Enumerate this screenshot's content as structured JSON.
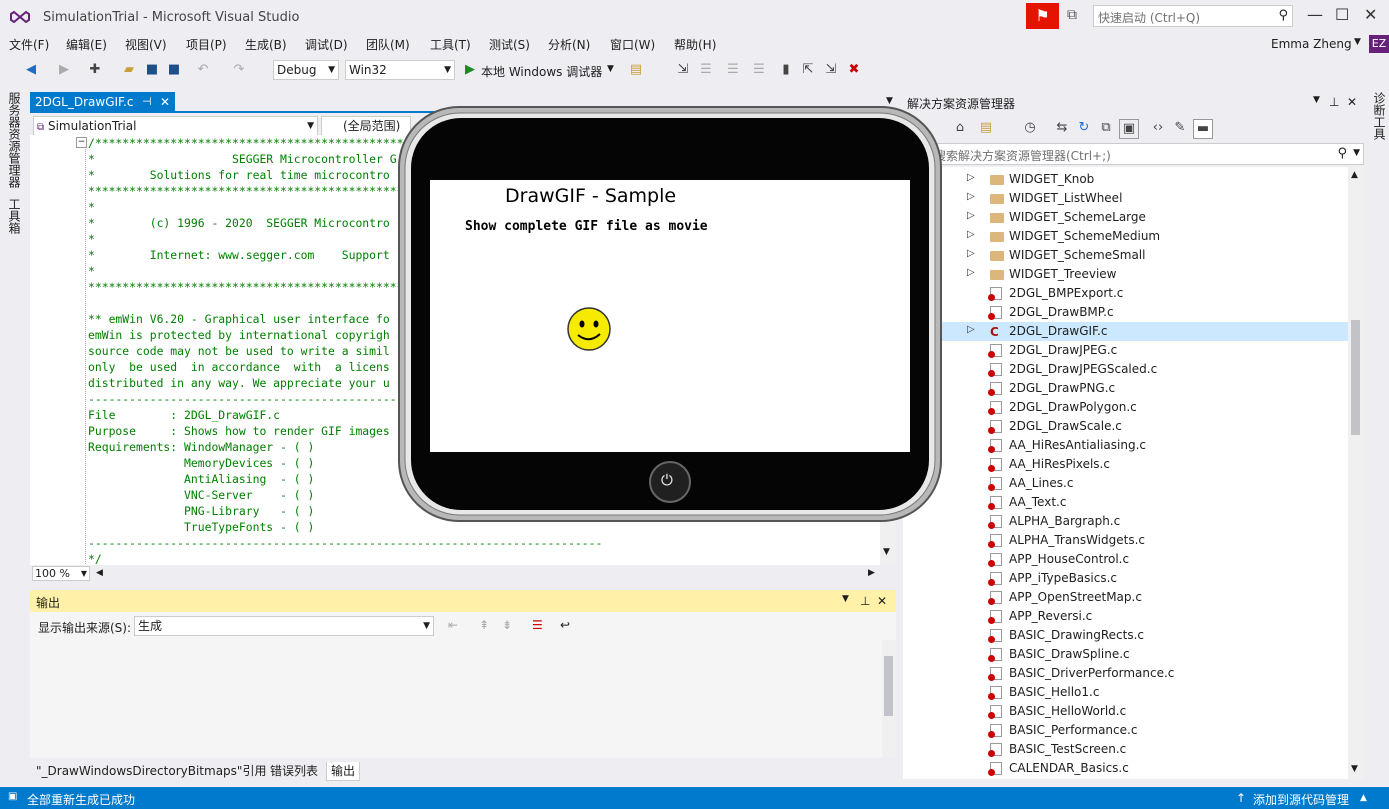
{
  "window": {
    "title": "SimulationTrial - Microsoft Visual Studio",
    "quick_launch_placeholder": "快速启动 (Ctrl+Q)",
    "user_name": "Emma Zheng",
    "user_initials": "EZ"
  },
  "menu": [
    "文件(F)",
    "编辑(E)",
    "视图(V)",
    "项目(P)",
    "生成(B)",
    "调试(D)",
    "团队(M)",
    "工具(T)",
    "测试(S)",
    "分析(N)",
    "窗口(W)",
    "帮助(H)"
  ],
  "toolbar": {
    "config": "Debug",
    "platform": "Win32",
    "run_label": "本地 Windows 调试器"
  },
  "left_rail": [
    "服务器资源管理器",
    "工具箱"
  ],
  "right_rail": [
    "诊断工具"
  ],
  "editor": {
    "tab_name": "2DGL_DrawGIF.c",
    "project_dropdown": "SimulationTrial",
    "scope_dropdown": "(全局范围)",
    "zoom": "100 %",
    "code_lines": [
      "/*****************************************************************",
      "*                    SEGGER Microcontroller G",
      "*        Solutions for real time microcontro",
      "*****************************************************************",
      "*",
      "*        (c) 1996 - 2020  SEGGER Microcontro",
      "*",
      "*        Internet: www.segger.com    Support",
      "*",
      "*****************************************************************",
      "",
      "** emWin V6.20 - Graphical user interface fo",
      "emWin is protected by international copyrigh",
      "source code may not be used to write a simil",
      "only  be used  in accordance  with  a licens",
      "distributed in any way. We appreciate your u",
      "-----------------------------------------------------------------",
      "File        : 2DGL_DrawGIF.c",
      "Purpose     : Shows how to render GIF images",
      "Requirements: WindowManager - ( )",
      "              MemoryDevices - ( )",
      "              AntiAliasing  - ( )",
      "              VNC-Server    - ( )",
      "              PNG-Library   - ( )",
      "              TrueTypeFonts - ( )",
      "---------------------------------------------------------------------------",
      "*/"
    ]
  },
  "output": {
    "title": "输出",
    "source_label": "显示输出来源(S):",
    "source_value": "生成"
  },
  "bottom_tabs": [
    "\"_DrawWindowsDirectoryBitmaps\"引用",
    "错误列表",
    "输出"
  ],
  "solution_explorer": {
    "title": "解决方案资源管理器",
    "search_placeholder": "搜索解决方案资源管理器(Ctrl+;)",
    "items": [
      {
        "label": "WIDGET_Knob",
        "type": "folder"
      },
      {
        "label": "WIDGET_ListWheel",
        "type": "folder"
      },
      {
        "label": "WIDGET_SchemeLarge",
        "type": "folder"
      },
      {
        "label": "WIDGET_SchemeMedium",
        "type": "folder"
      },
      {
        "label": "WIDGET_SchemeSmall",
        "type": "folder"
      },
      {
        "label": "WIDGET_Treeview",
        "type": "folder"
      },
      {
        "label": "2DGL_BMPExport.c",
        "type": "file"
      },
      {
        "label": "2DGL_DrawBMP.c",
        "type": "file"
      },
      {
        "label": "2DGL_DrawGIF.c",
        "type": "file-selected"
      },
      {
        "label": "2DGL_DrawJPEG.c",
        "type": "file"
      },
      {
        "label": "2DGL_DrawJPEGScaled.c",
        "type": "file"
      },
      {
        "label": "2DGL_DrawPNG.c",
        "type": "file"
      },
      {
        "label": "2DGL_DrawPolygon.c",
        "type": "file"
      },
      {
        "label": "2DGL_DrawScale.c",
        "type": "file"
      },
      {
        "label": "AA_HiResAntialiasing.c",
        "type": "file"
      },
      {
        "label": "AA_HiResPixels.c",
        "type": "file"
      },
      {
        "label": "AA_Lines.c",
        "type": "file"
      },
      {
        "label": "AA_Text.c",
        "type": "file"
      },
      {
        "label": "ALPHA_Bargraph.c",
        "type": "file"
      },
      {
        "label": "ALPHA_TransWidgets.c",
        "type": "file"
      },
      {
        "label": "APP_HouseControl.c",
        "type": "file"
      },
      {
        "label": "APP_iTypeBasics.c",
        "type": "file"
      },
      {
        "label": "APP_OpenStreetMap.c",
        "type": "file"
      },
      {
        "label": "APP_Reversi.c",
        "type": "file"
      },
      {
        "label": "BASIC_DrawingRects.c",
        "type": "file"
      },
      {
        "label": "BASIC_DrawSpline.c",
        "type": "file"
      },
      {
        "label": "BASIC_DriverPerformance.c",
        "type": "file"
      },
      {
        "label": "BASIC_Hello1.c",
        "type": "file"
      },
      {
        "label": "BASIC_HelloWorld.c",
        "type": "file"
      },
      {
        "label": "BASIC_Performance.c",
        "type": "file"
      },
      {
        "label": "BASIC_TestScreen.c",
        "type": "file"
      },
      {
        "label": "CALENDAR_Basics.c",
        "type": "file"
      }
    ]
  },
  "simulator": {
    "title": "DrawGIF - Sample",
    "subtitle": "Show complete GIF file as movie",
    "power_icon": "⏻"
  },
  "status": {
    "left": "全部重新生成已成功",
    "right": "添加到源代码管理"
  }
}
